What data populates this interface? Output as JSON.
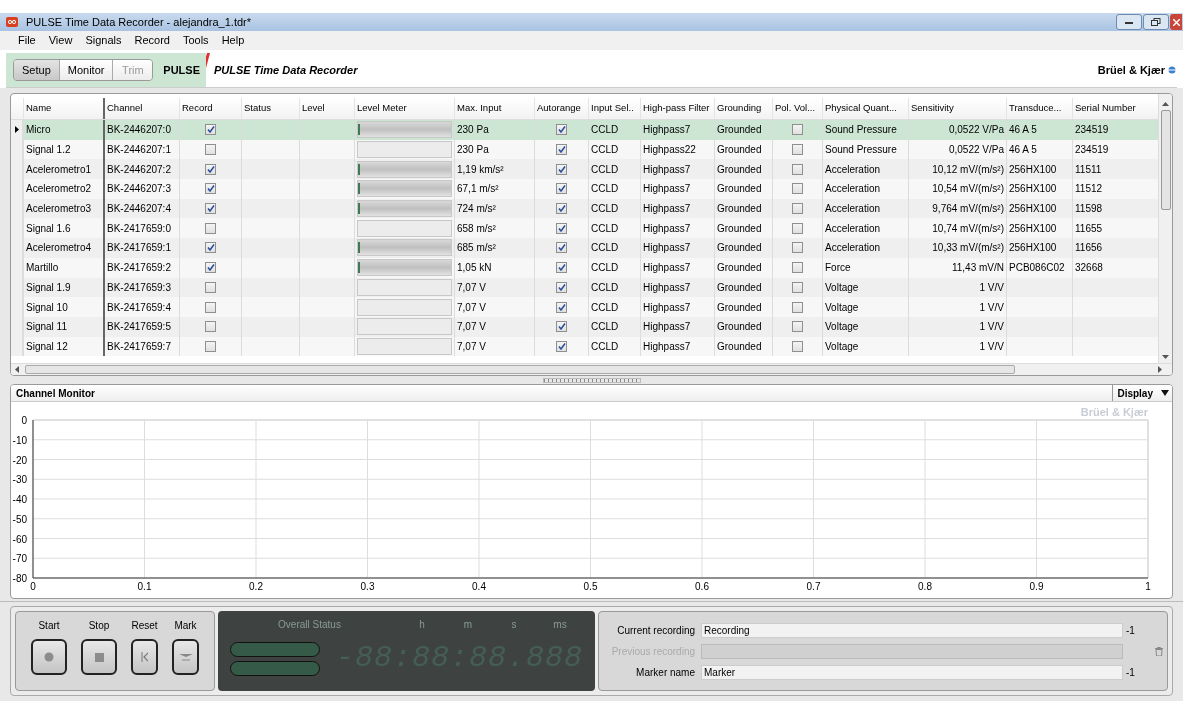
{
  "window": {
    "title": "PULSE Time Data Recorder - alejandra_1.tdr*"
  },
  "menu": [
    "File",
    "View",
    "Signals",
    "Record",
    "Tools",
    "Help"
  ],
  "mode_tabs": [
    {
      "label": "Setup",
      "selected": true,
      "disabled": false
    },
    {
      "label": "Monitor",
      "selected": false,
      "disabled": false
    },
    {
      "label": "Trim",
      "selected": false,
      "disabled": true
    }
  ],
  "app_badge": "PULSE",
  "app_title": "PULSE Time Data Recorder",
  "brand": "Brüel & Kjær",
  "table": {
    "columns": [
      "Name",
      "Channel",
      "Record",
      "Status",
      "Level",
      "Level Meter",
      "Max. Input",
      "Autorange",
      "Input Sel..",
      "High-pass Filter",
      "Grounding",
      "Pol. Vol...",
      "Physical Quant...",
      "Sensitivity",
      "Transduce...",
      "Serial Number"
    ],
    "rows": [
      {
        "selected": true,
        "name": "Micro",
        "channel": "BK-2446207:0",
        "record": true,
        "level": 0.02,
        "max_input": "230 Pa",
        "autorange": true,
        "input_sel": "CCLD",
        "highpass": "Highpass7",
        "grounding": "Grounded",
        "pol_vol": false,
        "physical": "Sound Pressure",
        "sensitivity": "0,0522 V/Pa",
        "transducer": "46 A 5",
        "serial": "234519"
      },
      {
        "selected": false,
        "name": "Signal 1.2",
        "channel": "BK-2446207:1",
        "record": false,
        "max_input": "230 Pa",
        "autorange": true,
        "input_sel": "CCLD",
        "highpass": "Highpass22",
        "grounding": "Grounded",
        "pol_vol": false,
        "physical": "Sound Pressure",
        "sensitivity": "0,0522 V/Pa",
        "transducer": "46 A 5",
        "serial": "234519"
      },
      {
        "selected": false,
        "name": "Acelerometro1",
        "channel": "BK-2446207:2",
        "record": true,
        "level": 0.02,
        "max_input": "1,19 km/s²",
        "autorange": true,
        "input_sel": "CCLD",
        "highpass": "Highpass7",
        "grounding": "Grounded",
        "pol_vol": false,
        "physical": "Acceleration",
        "sensitivity": "10,12 mV/(m/s²)",
        "transducer": "256HX100",
        "serial": "11511"
      },
      {
        "selected": false,
        "name": "Acelerometro2",
        "channel": "BK-2446207:3",
        "record": true,
        "level": 0.02,
        "max_input": "67,1 m/s²",
        "autorange": true,
        "input_sel": "CCLD",
        "highpass": "Highpass7",
        "grounding": "Grounded",
        "pol_vol": false,
        "physical": "Acceleration",
        "sensitivity": "10,54 mV/(m/s²)",
        "transducer": "256HX100",
        "serial": "11512"
      },
      {
        "selected": false,
        "name": "Acelerometro3",
        "channel": "BK-2446207:4",
        "record": true,
        "level": 0.02,
        "max_input": "724 m/s²",
        "autorange": true,
        "input_sel": "CCLD",
        "highpass": "Highpass7",
        "grounding": "Grounded",
        "pol_vol": false,
        "physical": "Acceleration",
        "sensitivity": "9,764 mV/(m/s²)",
        "transducer": "256HX100",
        "serial": "11598"
      },
      {
        "selected": false,
        "name": "Signal 1.6",
        "channel": "BK-2417659:0",
        "record": false,
        "max_input": "658 m/s²",
        "autorange": true,
        "input_sel": "CCLD",
        "highpass": "Highpass7",
        "grounding": "Grounded",
        "pol_vol": false,
        "physical": "Acceleration",
        "sensitivity": "10,74 mV/(m/s²)",
        "transducer": "256HX100",
        "serial": "11655"
      },
      {
        "selected": false,
        "name": "Acelerometro4",
        "channel": "BK-2417659:1",
        "record": true,
        "level": 0.02,
        "max_input": "685 m/s²",
        "autorange": true,
        "input_sel": "CCLD",
        "highpass": "Highpass7",
        "grounding": "Grounded",
        "pol_vol": false,
        "physical": "Acceleration",
        "sensitivity": "10,33 mV/(m/s²)",
        "transducer": "256HX100",
        "serial": "11656"
      },
      {
        "selected": false,
        "name": "Martillo",
        "channel": "BK-2417659:2",
        "record": true,
        "level": 0.02,
        "max_input": "1,05 kN",
        "autorange": true,
        "input_sel": "CCLD",
        "highpass": "Highpass7",
        "grounding": "Grounded",
        "pol_vol": false,
        "physical": "Force",
        "sensitivity": "11,43 mV/N",
        "transducer": "PCB086C02",
        "serial": "32668"
      },
      {
        "selected": false,
        "name": "Signal 1.9",
        "channel": "BK-2417659:3",
        "record": false,
        "max_input": "7,07 V",
        "autorange": true,
        "input_sel": "CCLD",
        "highpass": "Highpass7",
        "grounding": "Grounded",
        "pol_vol": false,
        "physical": "Voltage",
        "sensitivity": "1 V/V"
      },
      {
        "selected": false,
        "name": "Signal 10",
        "channel": "BK-2417659:4",
        "record": false,
        "max_input": "7,07 V",
        "autorange": true,
        "input_sel": "CCLD",
        "highpass": "Highpass7",
        "grounding": "Grounded",
        "pol_vol": false,
        "physical": "Voltage",
        "sensitivity": "1 V/V"
      },
      {
        "selected": false,
        "name": "Signal 11",
        "channel": "BK-2417659:5",
        "record": false,
        "max_input": "7,07 V",
        "autorange": true,
        "input_sel": "CCLD",
        "highpass": "Highpass7",
        "grounding": "Grounded",
        "pol_vol": false,
        "physical": "Voltage",
        "sensitivity": "1 V/V"
      },
      {
        "selected": false,
        "name": "Signal 12",
        "channel": "BK-2417659:7",
        "record": false,
        "max_input": "7,07 V",
        "autorange": true,
        "input_sel": "CCLD",
        "highpass": "Highpass7",
        "grounding": "Grounded",
        "pol_vol": false,
        "physical": "Voltage",
        "sensitivity": "1 V/V"
      }
    ]
  },
  "channel_monitor": {
    "title": "Channel Monitor",
    "display_button": "Display",
    "watermark": "Brüel & Kjær",
    "chart_data": {
      "type": "line",
      "grid": true,
      "xlim": [
        0,
        1
      ],
      "ylim": [
        -80,
        0
      ],
      "xticks": [
        0,
        0.1,
        0.2,
        0.3,
        0.4,
        0.5,
        0.6,
        0.7,
        0.8,
        0.9,
        1
      ],
      "yticks": [
        0,
        -10,
        -20,
        -30,
        -40,
        -50,
        -60,
        -70,
        -80
      ]
    }
  },
  "transport": [
    {
      "label": "Start",
      "kind": "record"
    },
    {
      "label": "Stop",
      "kind": "stop"
    },
    {
      "label": "Reset",
      "kind": "reset"
    },
    {
      "label": "Mark",
      "kind": "mark"
    }
  ],
  "status_display": {
    "title": "Overall Status",
    "units": [
      "h",
      "m",
      "s",
      "ms"
    ],
    "clock": "-88:88:88.888"
  },
  "recording": [
    {
      "label": "Current recording",
      "value": "Recording",
      "count": "-1",
      "disabled": false
    },
    {
      "label": "Previous recording",
      "disabled": true
    },
    {
      "label": "Marker name",
      "value": "Marker",
      "count": "-1",
      "disabled": false
    }
  ]
}
